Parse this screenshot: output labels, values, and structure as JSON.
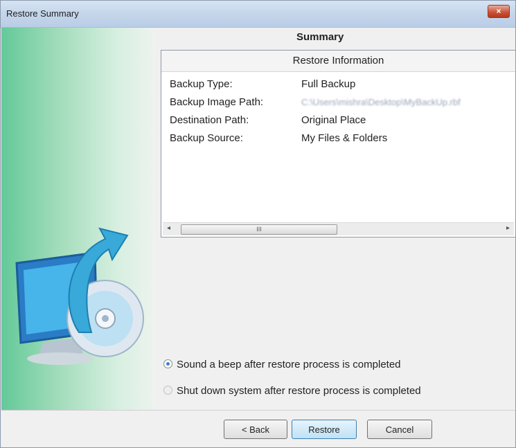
{
  "window": {
    "title": "Restore Summary",
    "close_glyph": "×"
  },
  "summary": {
    "heading": "Summary"
  },
  "info": {
    "header": "Restore Information",
    "rows": [
      {
        "label": "Backup Type:",
        "value": "Full Backup"
      },
      {
        "label": "Backup Image Path:",
        "value": "C:\\Users\\mishra\\Desktop\\MyBackUp.rbf"
      },
      {
        "label": "Destination Path:",
        "value": "Original Place"
      },
      {
        "label": "Backup Source:",
        "value": "My Files & Folders"
      }
    ],
    "scroll": {
      "left_arrow": "◂",
      "right_arrow": "▸",
      "grip": "III"
    }
  },
  "options": {
    "beep": {
      "label": "Sound a beep after restore process is completed",
      "selected": true
    },
    "shutdown": {
      "label": "Shut down system after restore process is completed",
      "selected": false
    }
  },
  "buttons": {
    "back": "< Back",
    "restore": "Restore",
    "cancel": "Cancel"
  },
  "colors": {
    "accent": "#3a7fd0",
    "panel_green": "#63c998",
    "close_red": "#c84f35"
  },
  "icons": [
    "close-icon",
    "restore-computer-disc-icon"
  ]
}
